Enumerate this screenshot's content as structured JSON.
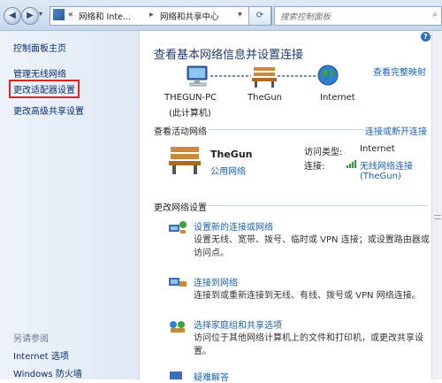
{
  "address": {
    "back_arrow": "◀",
    "forward_arrow": "▶",
    "crumb_prefix": "«",
    "crumb1": "网络和 Inte...",
    "sep": "▸",
    "crumb2": "网络和共享中心",
    "dropdown": "▾",
    "refresh": "⟳",
    "search_placeholder": "搜索控制面板"
  },
  "sidebar": {
    "home": "控制面板主页",
    "items": [
      "管理无线网络",
      "更改适配器设置",
      "更改高级共享设置"
    ],
    "see_also_title": "另请参阅",
    "see_also": [
      "Internet 选项",
      "Windows 防火墙"
    ]
  },
  "main": {
    "help": "?",
    "title": "查看基本网络信息并设置连接",
    "view_full_map": "查看完整映射",
    "map": {
      "pc_name": "THEGUN-PC",
      "pc_sub": "(此计算机)",
      "network": "TheGun",
      "internet": "Internet"
    },
    "active": {
      "section": "查看活动网络",
      "connect_link": "连接或断开连接",
      "name": "TheGun",
      "type": "公用网络",
      "access_label": "访问类型:",
      "access_value": "Internet",
      "conn_label": "连接:",
      "conn_value": "无线网络连接",
      "conn_value2": "(TheGun)"
    },
    "change": {
      "section": "更改网络设置",
      "tasks": [
        {
          "title": "设置新的连接或网络",
          "desc1": "设置无线、宽带、拨号、临时或 VPN 连接；或设置路由器或",
          "desc2": "访问点。"
        },
        {
          "title": "连接到网络",
          "desc1": "连接到或重新连接到无线、有线、拨号或 VPN 网络连接。",
          "desc2": ""
        },
        {
          "title": "选择家庭组和共享选项",
          "desc1": "访问位于其他网络计算机上的文件和打印机，或更改共享设",
          "desc2": "置。"
        },
        {
          "title": "疑难解答",
          "desc1": "",
          "desc2": ""
        }
      ]
    }
  },
  "colors": {
    "link": "#1b5fb4",
    "highlight": "#e02424"
  }
}
